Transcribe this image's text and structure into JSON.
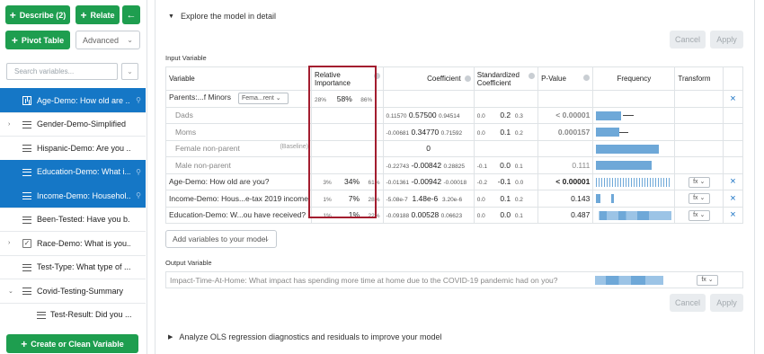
{
  "sidebar": {
    "describe_label": "Describe (2)",
    "relate_label": "Relate",
    "back_arrow": "←",
    "pivot_label": "Pivot Table",
    "advanced_label": "Advanced",
    "search_placeholder": "Search variables...",
    "create_label": "Create or Clean Variable",
    "variables": [
      {
        "name": "Age-Demo: How old are ...",
        "icon": "bar-chart-icon",
        "selected": true
      },
      {
        "name": "Gender-Demo-Simplified",
        "icon": "list-icon",
        "selected": false,
        "expandable": true
      },
      {
        "name": "Hispanic-Demo: Are you ...",
        "icon": "list-icon",
        "selected": false
      },
      {
        "name": "Education-Demo: What i...",
        "icon": "list-icon",
        "selected": true
      },
      {
        "name": "Income-Demo: Househol...",
        "icon": "list-icon",
        "selected": true
      },
      {
        "name": "Been-Tested: Have you b...",
        "icon": "list-icon",
        "selected": false
      },
      {
        "name": "Race-Demo: What is you...",
        "icon": "checkbox-icon",
        "selected": false,
        "expandable": true
      },
      {
        "name": "Test-Type: What type of ...",
        "icon": "list-icon",
        "selected": false
      },
      {
        "name": "Covid-Testing-Summary",
        "icon": "list-icon",
        "selected": false,
        "expanded": true
      },
      {
        "name": "Test-Result: Did you ...",
        "icon": "list-icon",
        "selected": false,
        "indent": true
      }
    ]
  },
  "main": {
    "explore_title": "Explore the model in detail",
    "cancel_label": "Cancel",
    "apply_label": "Apply",
    "input_variable_label": "Input Variable",
    "headers": {
      "variable": "Variable",
      "relative_importance": "Relative\nImportance",
      "coefficient": "Coefficient",
      "standardized": "Standardized\nCoefficient",
      "pvalue": "P-Value",
      "frequency": "Frequency",
      "transform": "Transform"
    },
    "rows": [
      {
        "var": "Parents:...f Minors",
        "ref": "Fema...rent",
        "ri_lo": "28%",
        "ri": "58%",
        "ri_hi": "86%",
        "c_lo": "",
        "c": "",
        "c_hi": "",
        "s_lo": "",
        "s": "",
        "s_hi": "",
        "p": "",
        "sub": false,
        "remove": true
      },
      {
        "var": "Dads",
        "ri_lo": "",
        "ri": "",
        "ri_hi": "",
        "c_lo": "0.11570",
        "c": "0.57500",
        "c_hi": "0.94514",
        "s_lo": "0.0",
        "s": "0.2",
        "s_hi": "0.3",
        "p": "< 0.00001",
        "p_bold": true,
        "sub": true
      },
      {
        "var": "Moms",
        "ri_lo": "",
        "ri": "",
        "ri_hi": "",
        "c_lo": "-0.00681",
        "c": "0.34770",
        "c_hi": "0.71592",
        "s_lo": "0.0",
        "s": "0.1",
        "s_hi": "0.2",
        "p": "0.000157",
        "p_bold": true,
        "sub": true
      },
      {
        "var": "Female non-parent",
        "baseline": "(Baseline)",
        "c": "0",
        "sub": true
      },
      {
        "var": "Male non-parent",
        "c_lo": "-0.22743",
        "c": "-0.00842",
        "c_hi": "0.28825",
        "s_lo": "-0.1",
        "s": "0.0",
        "s_hi": "0.1",
        "p": "0.111",
        "sub": true
      },
      {
        "var": "Age-Demo: How old are you?",
        "ri_lo": "3%",
        "ri": "34%",
        "ri_hi": "61%",
        "c_lo": "-0.01361",
        "c": "-0.00942",
        "c_hi": "-0.00018",
        "s_lo": "-0.2",
        "s": "-0.1",
        "s_hi": "0.0",
        "p": "< 0.00001",
        "p_bold": true,
        "fx": true,
        "remove": true
      },
      {
        "var": "Income-Demo: Hous...e-tax 2019 income",
        "ri_lo": "1%",
        "ri": "7%",
        "ri_hi": "28%",
        "c_lo": "-5.08e-7",
        "c": "1.48e-6",
        "c_hi": "3.20e-6",
        "s_lo": "0.0",
        "s": "0.1",
        "s_hi": "0.2",
        "p": "0.143",
        "fx": true,
        "remove": true
      },
      {
        "var": "Education-Demo: W...ou have received?",
        "ri_lo": "1%",
        "ri": "1%",
        "ri_hi": "22%",
        "c_lo": "-0.09188",
        "c": "0.00528",
        "c_hi": "0.06623",
        "s_lo": "0.0",
        "s": "0.0",
        "s_hi": "0.1",
        "p": "0.487",
        "fx": true,
        "remove": true
      }
    ],
    "add_variables_label": "Add variables to your model",
    "output_variable_label": "Output Variable",
    "output_variable": "Impact-Time-At-Home: What impact has spending more time at home due to the COVID-19 pandemic had on you?",
    "diagnostics_title": "Analyze OLS regression diagnostics and residuals to improve your model",
    "fx_label": "fx",
    "remove_symbol": "×"
  },
  "colors": {
    "accent_green": "#1e9e4f",
    "selected_blue": "#1577c6",
    "highlight_red": "#a31d2f",
    "bar_blue": "#6ea8d8"
  }
}
